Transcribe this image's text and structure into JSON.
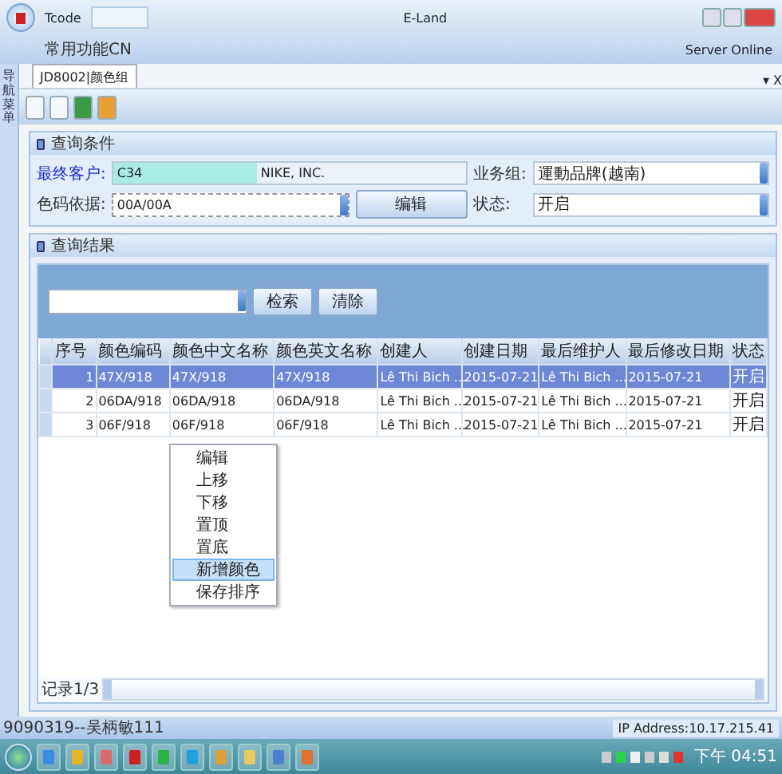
{
  "window": {
    "title": "E-Land"
  },
  "tcode": {
    "label": "Tcode"
  },
  "menu": {
    "label": "常用功能CN"
  },
  "server_status": "Server Online",
  "sidebar": {
    "label": "导航菜单"
  },
  "tab": {
    "label": "JD8002|颜色组",
    "selected": true
  },
  "tab_controls": "▾ X",
  "query": {
    "title": "查询条件",
    "customer": {
      "label": "最终客户:",
      "code": "C34",
      "name": "NIKE, INC."
    },
    "business_group": {
      "label": "业务组:",
      "value": "運動品牌(越南)"
    },
    "color_basis": {
      "label": "色码依据:",
      "value": "00A/00A"
    },
    "edit_button": "编辑",
    "status": {
      "label": "状态:",
      "value": "开启"
    }
  },
  "results": {
    "title": "查询结果",
    "search_button": "检索",
    "clear_button": "清除",
    "columns": [
      "序号",
      "颜色编码",
      "颜色中文名称",
      "颜色英文名称",
      "创建人",
      "创建日期",
      "最后维护人",
      "最后修改日期",
      "状态"
    ],
    "rows": [
      {
        "selected": true,
        "cells": [
          "1",
          "47X/918",
          "47X/918",
          "47X/918",
          "Lê Thi Bich ...",
          "2015-07-21",
          "Lê Thi Bich ...",
          "2015-07-21",
          "开启"
        ]
      },
      {
        "selected": false,
        "cells": [
          "2",
          "06DA/918",
          "06DA/918",
          "06DA/918",
          "Lê Thi Bich ...",
          "2015-07-21",
          "Lê Thi Bich ...",
          "2015-07-21",
          "开启"
        ]
      },
      {
        "selected": false,
        "cells": [
          "3",
          "06F/918",
          "06F/918",
          "06F/918",
          "Lê Thi Bich ...",
          "2015-07-21",
          "Lê Thi Bich ...",
          "2015-07-21",
          "开启"
        ]
      }
    ],
    "context_menu": [
      {
        "label": "编辑",
        "selected": false
      },
      {
        "label": "上移",
        "selected": false
      },
      {
        "label": "下移",
        "selected": false
      },
      {
        "label": "置顶",
        "selected": false
      },
      {
        "label": "置底",
        "selected": false
      },
      {
        "label": "新增颜色",
        "selected": true
      },
      {
        "label": "保存排序",
        "selected": false
      }
    ],
    "record": "记录1/3"
  },
  "status_bar": {
    "user": "9090319--吴柄敏111",
    "ip": "IP Address:10.17.215.41"
  },
  "taskbar": {
    "clock": "下午 04:51"
  }
}
